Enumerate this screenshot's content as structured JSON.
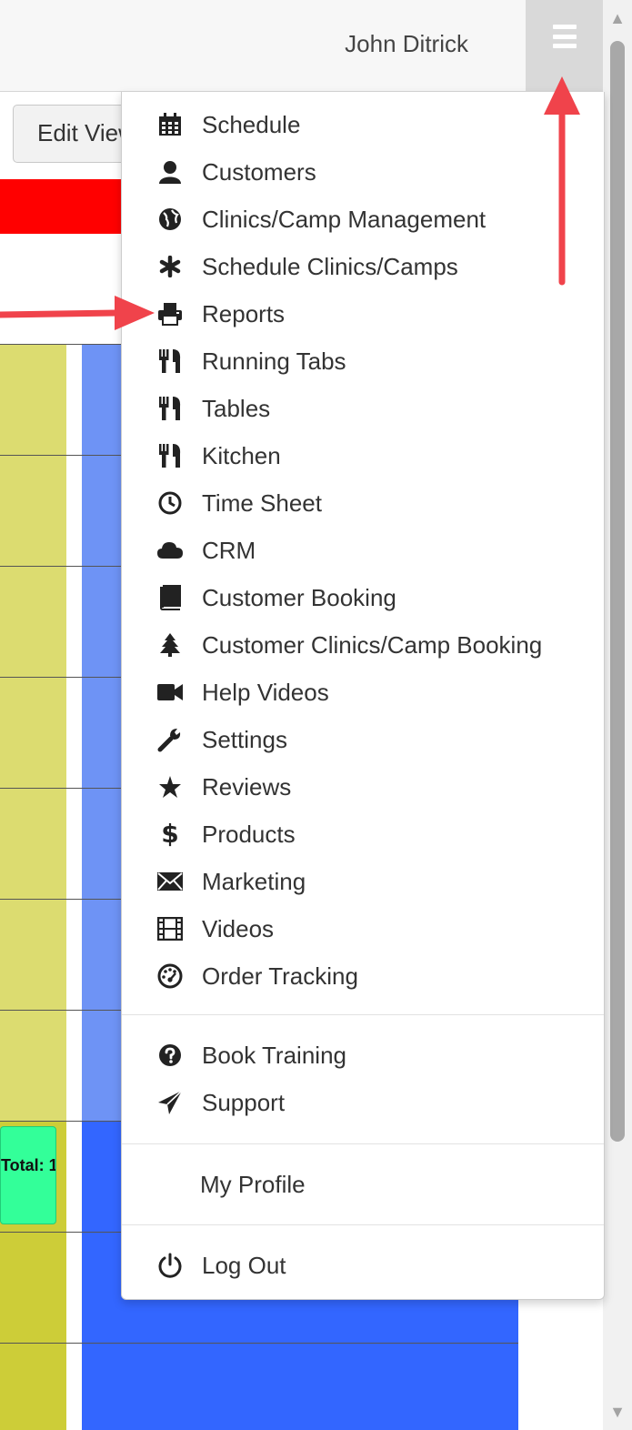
{
  "header": {
    "username": "John Ditrick",
    "menu_icon": "hamburger-icon"
  },
  "toolbar": {
    "edit_view_label": "Edit View"
  },
  "schedule": {
    "booking_label": "Total: 1"
  },
  "menu": {
    "items": [
      {
        "label": "Schedule",
        "icon": "calendar-icon"
      },
      {
        "label": "Customers",
        "icon": "user-icon"
      },
      {
        "label": "Clinics/Camp Management",
        "icon": "globe-icon"
      },
      {
        "label": "Schedule Clinics/Camps",
        "icon": "asterisk-icon"
      },
      {
        "label": "Reports",
        "icon": "print-icon"
      },
      {
        "label": "Running Tabs",
        "icon": "cutlery-icon"
      },
      {
        "label": "Tables",
        "icon": "cutlery-icon"
      },
      {
        "label": "Kitchen",
        "icon": "cutlery-icon"
      },
      {
        "label": "Time Sheet",
        "icon": "clock-icon"
      },
      {
        "label": "CRM",
        "icon": "cloud-icon"
      },
      {
        "label": "Customer Booking",
        "icon": "book-icon"
      },
      {
        "label": "Customer Clinics/Camp Booking",
        "icon": "tree-icon"
      },
      {
        "label": "Help Videos",
        "icon": "video-camera-icon"
      },
      {
        "label": "Settings",
        "icon": "wrench-icon"
      },
      {
        "label": "Reviews",
        "icon": "star-icon"
      },
      {
        "label": "Products",
        "icon": "dollar-icon"
      },
      {
        "label": "Marketing",
        "icon": "envelope-icon"
      },
      {
        "label": "Videos",
        "icon": "film-icon"
      },
      {
        "label": "Order Tracking",
        "icon": "dashboard-icon"
      }
    ],
    "help_items": [
      {
        "label": "Book Training",
        "icon": "question-icon"
      },
      {
        "label": "Support",
        "icon": "send-icon"
      }
    ],
    "profile_label": "My Profile",
    "logout": {
      "label": "Log Out",
      "icon": "power-icon"
    }
  },
  "colors": {
    "alert_red": "#ff0000",
    "column_yellow": "#dcdc70",
    "column_blue": "#6e93f5",
    "booking_green": "#33ff99",
    "annotation_arrow": "#f0434b"
  }
}
